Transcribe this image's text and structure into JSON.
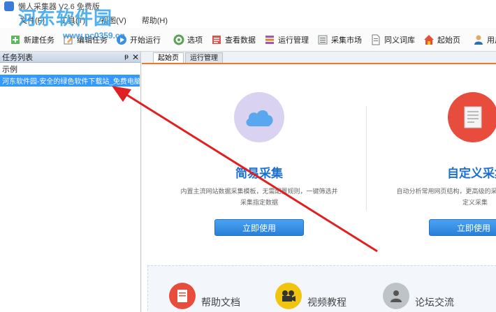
{
  "window": {
    "title": "懒人采集器 V2.6 免费版"
  },
  "watermark": {
    "text": "河东软件园",
    "url": "www.pc0359.cn"
  },
  "menu": [
    "文件(F)",
    "工具(T)",
    "视图(V)",
    "帮助(H)"
  ],
  "toolbar": {
    "new_task": "新建任务",
    "edit_task": "编辑任务",
    "start_run": "开始运行",
    "options": "选项",
    "view_data": "查看数据",
    "run_manage": "运行管理",
    "collect_market": "采集市场",
    "synonym_dict": "同义词库",
    "start_page": "起始页",
    "user_login": "用户登录"
  },
  "task_panel": {
    "title": "任务列表",
    "pin": "ᵽ",
    "close": "✕",
    "group": "示例",
    "item": "河东软件园-安全的绿色软件下载站_免费电脑软"
  },
  "tabs": [
    "起始页",
    "运行管理"
  ],
  "cards": [
    {
      "heading": "简易采集",
      "desc": "内置主流网站数据采集模板，无需配置规则，一键筛选并采集指定数据",
      "button": "立即使用"
    },
    {
      "heading": "自定义采集",
      "desc": "自动分析常用网页结构，更高级的采集功能，快速完成自定义采集",
      "button": "立即使用"
    }
  ],
  "bottom_links": [
    "帮助文档",
    "视频教程",
    "论坛交流"
  ],
  "colors": {
    "accent": "#3399ff",
    "heading": "#1a6fd0",
    "tab_border": "#e87a2c",
    "arrow": "#e02020"
  }
}
